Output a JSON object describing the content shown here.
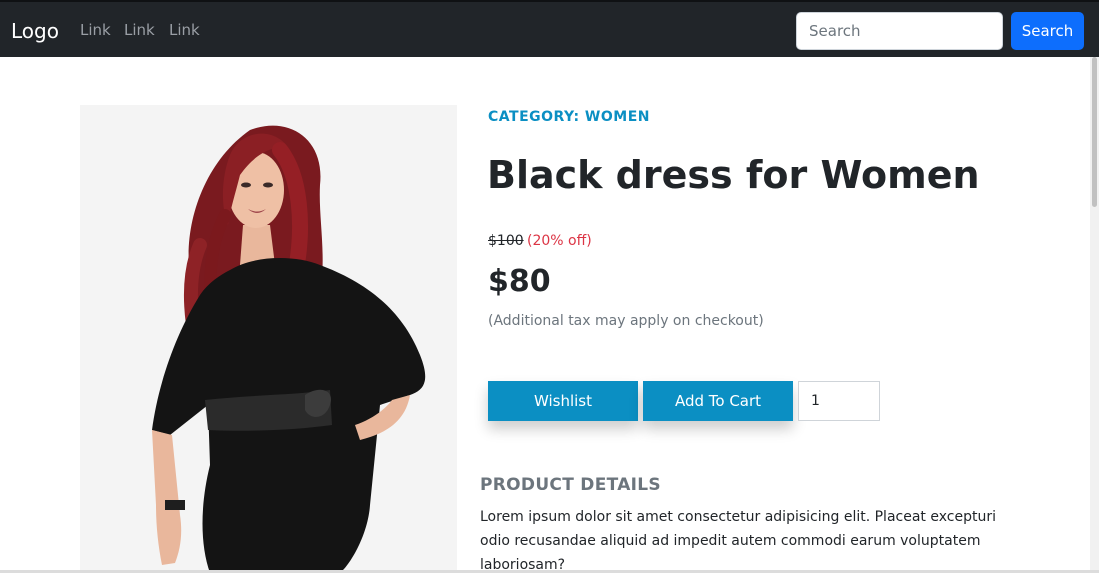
{
  "navbar": {
    "brand": "Logo",
    "links": [
      "Link",
      "Link",
      "Link"
    ],
    "search_placeholder": "Search",
    "search_button": "Search"
  },
  "product": {
    "category": "CATEGORY: WOMEN",
    "title": "Black dress for Women",
    "old_price": "$100",
    "discount": "(20% off)",
    "price": "$80",
    "tax_note": "(Additional tax may apply on checkout)",
    "wishlist_label": "Wishlist",
    "add_to_cart_label": "Add To Cart",
    "quantity": "1",
    "details_heading": "PRODUCT DETAILS",
    "details_text": "Lorem ipsum dolor sit amet consectetur adipisicing elit. Placeat excepturi odio recusandae aliquid ad impedit autem commodi earum voluptatem laboriosam?"
  },
  "colors": {
    "navbar_bg": "#212529",
    "primary_button": "#0d6efd",
    "accent": "#0b8fc3",
    "discount": "#dc3545"
  }
}
